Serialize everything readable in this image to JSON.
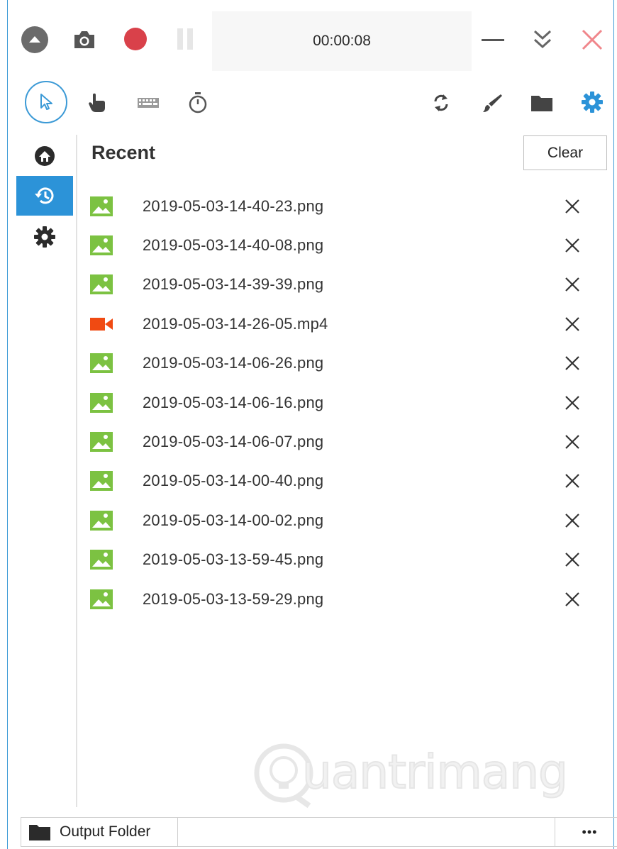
{
  "recorder": {
    "timer": "00:00:08"
  },
  "content": {
    "heading": "Recent",
    "clear_label": "Clear"
  },
  "files": [
    {
      "name": "2019-05-03-14-40-23.png",
      "type": "image"
    },
    {
      "name": "2019-05-03-14-40-08.png",
      "type": "image"
    },
    {
      "name": "2019-05-03-14-39-39.png",
      "type": "image"
    },
    {
      "name": "2019-05-03-14-26-05.mp4",
      "type": "video"
    },
    {
      "name": "2019-05-03-14-06-26.png",
      "type": "image"
    },
    {
      "name": "2019-05-03-14-06-16.png",
      "type": "image"
    },
    {
      "name": "2019-05-03-14-06-07.png",
      "type": "image"
    },
    {
      "name": "2019-05-03-14-00-40.png",
      "type": "image"
    },
    {
      "name": "2019-05-03-14-00-02.png",
      "type": "image"
    },
    {
      "name": "2019-05-03-13-59-45.png",
      "type": "image"
    },
    {
      "name": "2019-05-03-13-59-29.png",
      "type": "image"
    }
  ],
  "statusbar": {
    "output_folder_label": "Output Folder",
    "more_label": "•••"
  },
  "watermark": {
    "text": "uantrimang"
  },
  "icons": {
    "collapse": "chevron-up-circle-icon",
    "screenshot": "camera-icon",
    "record": "record-dot-icon",
    "pause": "pause-icon",
    "minimize": "minimize-icon",
    "hide": "double-chevron-down-icon",
    "close": "close-icon",
    "pointer": "mouse-pointer-icon",
    "clicks": "hand-pointer-icon",
    "keystrokes": "keyboard-icon",
    "timer": "stopwatch-icon",
    "switch": "swap-icon",
    "draw": "brush-icon",
    "folder": "folder-icon",
    "settings": "gear-icon",
    "home": "home-icon",
    "recent": "history-icon",
    "image_file": "image-file-icon",
    "video_file": "video-camera-icon",
    "remove": "x-icon"
  },
  "colors": {
    "accent": "#2c93d8",
    "record": "#d9414a",
    "close": "#f0868b",
    "image_icon": "#7cc242",
    "video_icon": "#f04a12"
  }
}
